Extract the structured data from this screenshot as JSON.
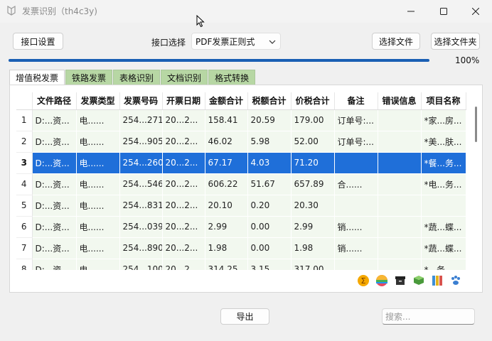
{
  "window": {
    "title": "发票识别（th4c3y)",
    "minimize_label": "minimize",
    "maximize_label": "maximize",
    "close_label": "close"
  },
  "top": {
    "interface_settings": "接口设置",
    "interface_select_label": "接口选择",
    "interface_select_value": "PDF发票正则式",
    "choose_file": "选择文件",
    "choose_folder": "选择文件夹"
  },
  "progress": {
    "value": 100,
    "text": "100%"
  },
  "tabs": [
    {
      "label": "增值税发票",
      "active": true
    },
    {
      "label": "铁路发票",
      "active": false
    },
    {
      "label": "表格识别",
      "active": false
    },
    {
      "label": "文档识别",
      "active": false
    },
    {
      "label": "格式转换",
      "active": false
    }
  ],
  "table": {
    "headers": [
      "文件路径",
      "发票类型",
      "发票号码",
      "开票日期",
      "金额合计",
      "税额合计",
      "价税合计",
      "备注",
      "错误信息",
      "项目名称"
    ],
    "rows": [
      {
        "num": "1",
        "cells": [
          "D:...资...",
          "电......",
          "254...271",
          "20...2...",
          "158.41",
          "20.59",
          "179.00",
          "订单号:...",
          "",
          "*家...房..."
        ]
      },
      {
        "num": "2",
        "cells": [
          "D:...资...",
          "电......",
          "254...905",
          "20...2...",
          "46.02",
          "5.98",
          "52.00",
          "订单号:...",
          "",
          "*美...肤..."
        ]
      },
      {
        "num": "3",
        "cells": [
          "D:...资...",
          "电......",
          "254...260",
          "20...2...",
          "67.17",
          "4.03",
          "71.20",
          "",
          "",
          "*餐...务..."
        ],
        "selected": true
      },
      {
        "num": "4",
        "cells": [
          "D:...资...",
          "电......",
          "254...546",
          "20...2...",
          "606.22",
          "51.67",
          "657.89",
          "合......",
          "",
          "*电...务..."
        ]
      },
      {
        "num": "5",
        "cells": [
          "D:...资...",
          "电......",
          "254...831",
          "20...2...",
          "20.10",
          "0.20",
          "20.30",
          "",
          "",
          ""
        ]
      },
      {
        "num": "6",
        "cells": [
          "D:...资...",
          "电......",
          "254...039",
          "20...2...",
          "2.99",
          "0.00",
          "2.99",
          "销......",
          "",
          "*蔬...蝶..."
        ]
      },
      {
        "num": "7",
        "cells": [
          "D:...资...",
          "电......",
          "254...890",
          "20...2...",
          "1.98",
          "0.00",
          "1.98",
          "销......",
          "",
          "*蔬...蝶..."
        ]
      },
      {
        "num": "8",
        "cells": [
          "D:...资...",
          "电......",
          "254...100",
          "20...2...",
          "314.25",
          "3.15",
          "317.00",
          "",
          "",
          "*...务..."
        ]
      }
    ]
  },
  "toolbar_icons": [
    "sum-icon",
    "color-wheel-icon",
    "archive-box-icon",
    "book-icon",
    "binders-icon",
    "paw-icon"
  ],
  "bottom": {
    "export": "导出",
    "search_placeholder": "搜索..."
  },
  "colors": {
    "accent": "#1f6fd9",
    "progress": "#1a5fb4",
    "tab_green": "#b7d7a4",
    "cell_green": "#f2f8ef"
  }
}
